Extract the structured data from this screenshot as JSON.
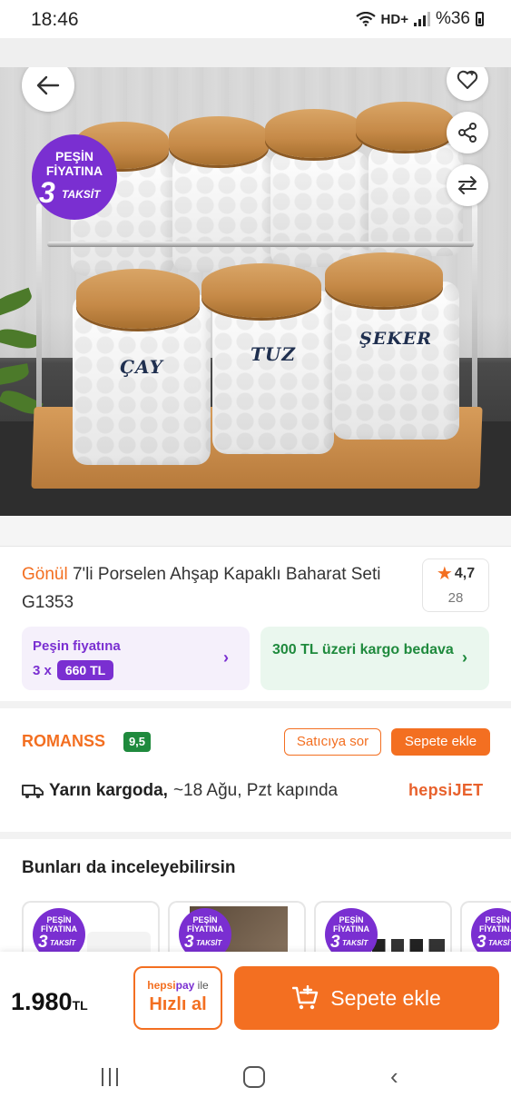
{
  "status_bar": {
    "time": "18:46",
    "network": "HD+",
    "battery": "%36"
  },
  "hero": {
    "badge": {
      "line1": "PEŞİN",
      "line2": "FİYATINA",
      "line3": "3",
      "line4": "TAKSİT"
    },
    "jar_labels": {
      "cay": "ÇAY",
      "tuz": "TUZ",
      "seker": "ŞEKER"
    },
    "icons": {
      "back": "arrow-left-icon",
      "favorite": "heart-icon",
      "share": "share-icon",
      "compare": "compare-arrows-icon"
    }
  },
  "product": {
    "brand": "Gönül",
    "title": "7'li Porselen Ahşap Kapaklı Baharat Seti G1353",
    "rating": "4,7",
    "review_count": "28"
  },
  "promos": {
    "installment": {
      "line1": "Peşin fiyatına",
      "prefix": "3 x",
      "amount": "660 TL"
    },
    "shipping": {
      "text": "300 TL üzeri kargo bedava"
    }
  },
  "seller": {
    "name": "ROMANSS",
    "score": "9,5",
    "ask_button": "Satıcıya sor",
    "add_button": "Sepete ekle"
  },
  "delivery": {
    "bold": "Yarın kargoda,",
    "detail": "~18 Ağu, Pzt kapında",
    "carrier": "hepsiJET"
  },
  "recommendations": {
    "title": "Bunları da inceleyebilirsin",
    "badge": {
      "line1": "PEŞİN",
      "line2": "FİYATINA",
      "line3": "3",
      "line4": "TAKSİT"
    }
  },
  "bottom": {
    "price": "1.980",
    "currency": "TL",
    "quick_pay_brand": "hepsi",
    "quick_pay_pay": "pay",
    "quick_pay_suffix": "ile",
    "quick_pay_label": "Hızlı al",
    "cart_label": "Sepete ekle"
  }
}
